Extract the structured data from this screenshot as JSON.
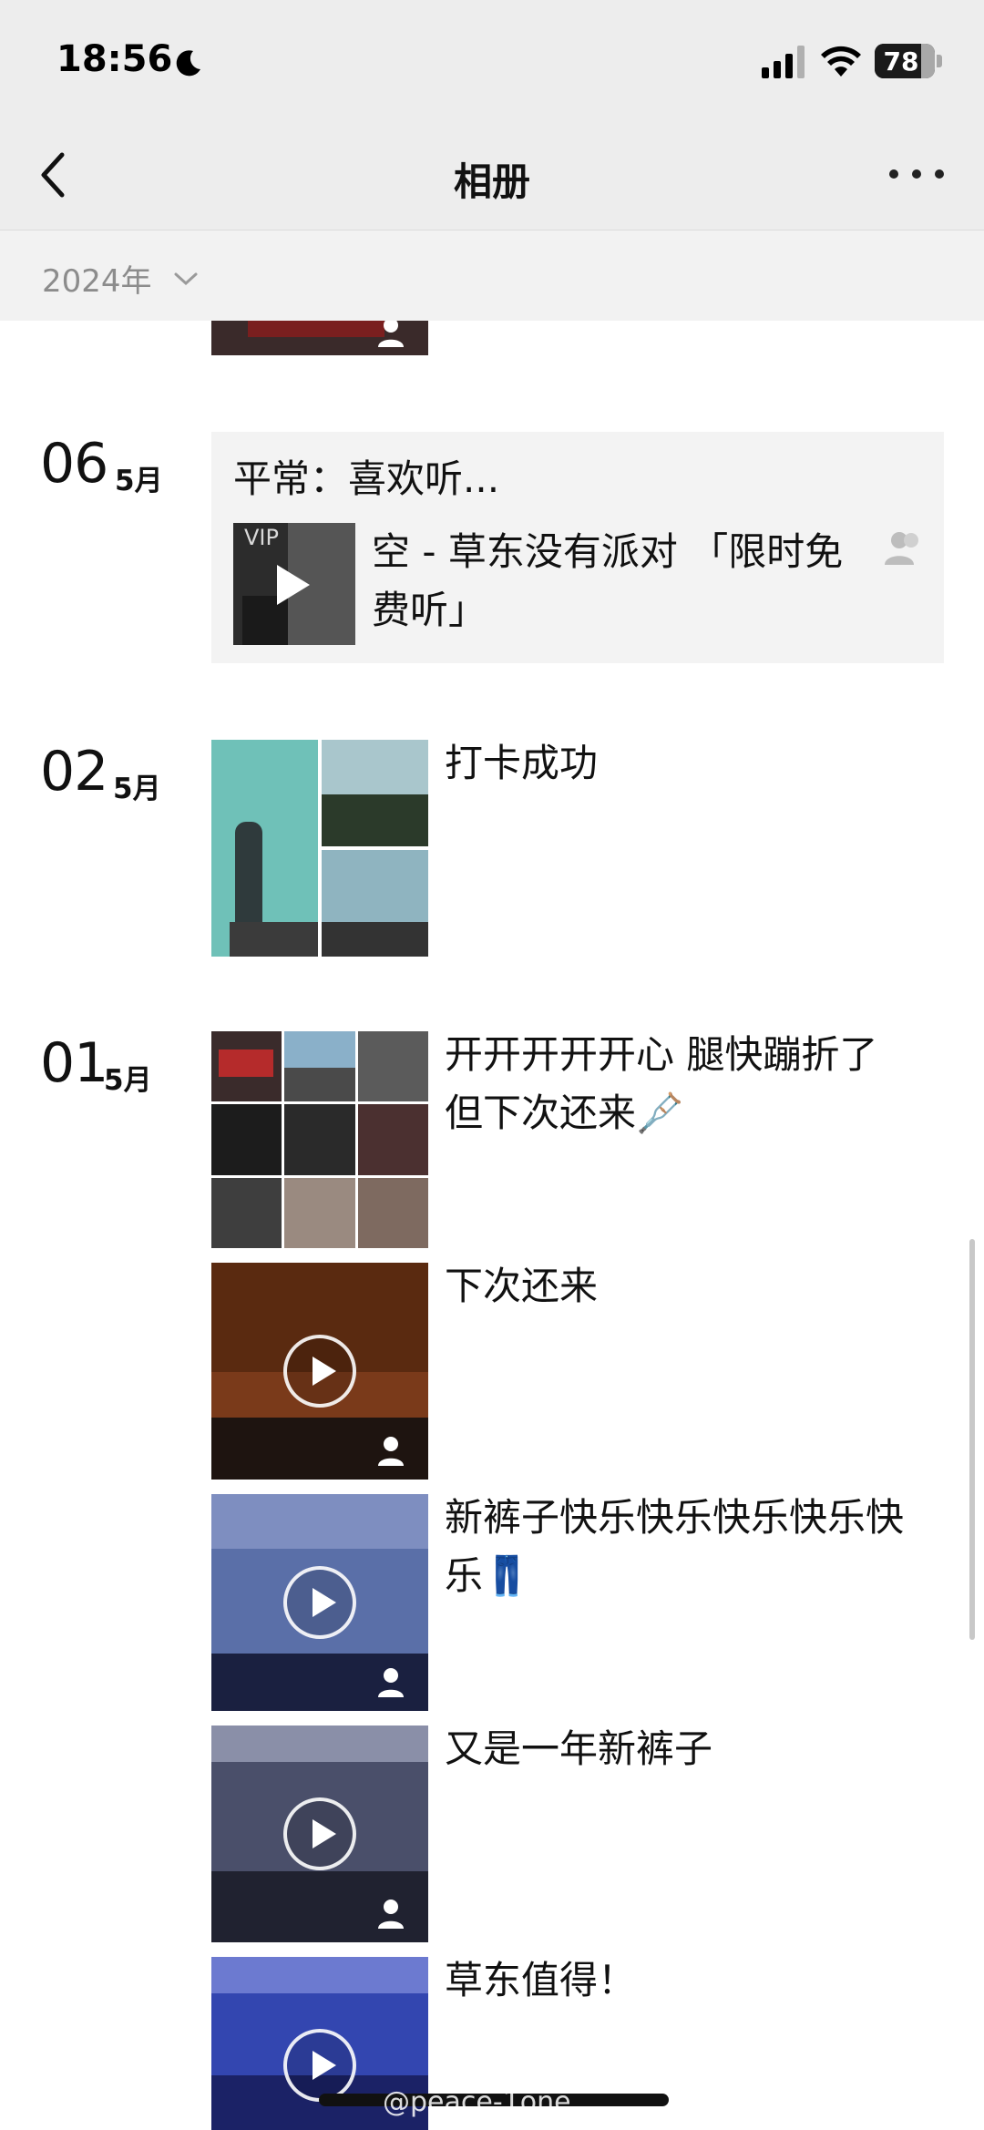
{
  "status_bar": {
    "time": "18:56",
    "battery": "78",
    "battery_level": 0.78
  },
  "nav": {
    "title": "相册"
  },
  "year_filter": {
    "label": "2024年"
  },
  "entries": [
    {
      "day": "06",
      "month": "5月",
      "card_title": "平常：喜欢听...",
      "vip_label": "VIP",
      "song": "空 - 草东没有派对 「限时免费听」"
    },
    {
      "day": "02",
      "month": "5月",
      "text": "打卡成功"
    },
    {
      "day": "01",
      "month": "5月",
      "posts": [
        {
          "text": "开开开开开心  腿快蹦折了 但下次还来🩼"
        },
        {
          "text": "下次还来"
        },
        {
          "text": "新裤子快乐快乐快乐快乐快乐👖"
        },
        {
          "text": "又是一年新裤子"
        },
        {
          "text": "草东值得！"
        }
      ]
    }
  ],
  "watermark": "@peace-1one",
  "icons": [
    "moon-icon",
    "signal-icon",
    "wifi-icon",
    "battery-icon",
    "back-chevron-icon",
    "more-dots-icon",
    "chevron-down-icon",
    "play-icon",
    "people-icon"
  ],
  "colors": {
    "header_bg": "#ededed",
    "card_bg": "#f3f3f3",
    "muted_text": "#8c8c8c"
  }
}
